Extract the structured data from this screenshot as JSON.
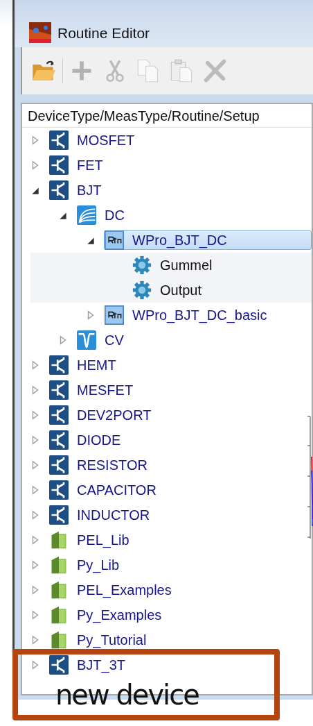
{
  "window": {
    "title": "Routine Editor"
  },
  "toolbar": [
    {
      "kind": "open",
      "disabled": false
    },
    {
      "kind": "add",
      "disabled": true
    },
    {
      "kind": "cut",
      "disabled": true
    },
    {
      "kind": "copy",
      "disabled": true
    },
    {
      "kind": "paste",
      "disabled": true
    },
    {
      "kind": "delete",
      "disabled": true
    }
  ],
  "tree": {
    "header": "DeviceType/MeasType/Routine/Setup",
    "items": [
      {
        "label": "MOSFET",
        "kind": "device",
        "expanded": false,
        "selected": false
      },
      {
        "label": "FET",
        "kind": "device",
        "expanded": false,
        "selected": false
      },
      {
        "label": "BJT",
        "kind": "device",
        "expanded": true,
        "selected": false,
        "children": [
          {
            "label": "DC",
            "kind": "dc",
            "expanded": true,
            "selected": false,
            "children": [
              {
                "label": "WPro_BJT_DC",
                "kind": "routine",
                "expanded": true,
                "selected": true,
                "children": [
                  {
                    "label": "Gummel",
                    "kind": "setup",
                    "selected": false
                  },
                  {
                    "label": "Output",
                    "kind": "setup",
                    "selected": false
                  }
                ]
              },
              {
                "label": "WPro_BJT_DC_basic",
                "kind": "routine",
                "expanded": false,
                "selected": false
              }
            ]
          },
          {
            "label": "CV",
            "kind": "cv",
            "expanded": false,
            "selected": false
          }
        ]
      },
      {
        "label": "HEMT",
        "kind": "device",
        "expanded": false,
        "selected": false
      },
      {
        "label": "MESFET",
        "kind": "device",
        "expanded": false,
        "selected": false
      },
      {
        "label": "DEV2PORT",
        "kind": "device",
        "expanded": false,
        "selected": false
      },
      {
        "label": "DIODE",
        "kind": "device",
        "expanded": false,
        "selected": false
      },
      {
        "label": "RESISTOR",
        "kind": "device",
        "expanded": false,
        "selected": false
      },
      {
        "label": "CAPACITOR",
        "kind": "device",
        "expanded": false,
        "selected": false
      },
      {
        "label": "INDUCTOR",
        "kind": "device",
        "expanded": false,
        "selected": false
      },
      {
        "label": "PEL_Lib",
        "kind": "library",
        "expanded": false,
        "selected": false
      },
      {
        "label": "Py_Lib",
        "kind": "library",
        "expanded": false,
        "selected": false
      },
      {
        "label": "PEL_Examples",
        "kind": "library",
        "expanded": false,
        "selected": false
      },
      {
        "label": "Py_Examples",
        "kind": "library",
        "expanded": false,
        "selected": false
      },
      {
        "label": "Py_Tutorial",
        "kind": "library",
        "expanded": false,
        "selected": false
      },
      {
        "label": "BJT_3T",
        "kind": "device",
        "expanded": false,
        "selected": false
      }
    ]
  },
  "callout": {
    "text": "new device"
  }
}
